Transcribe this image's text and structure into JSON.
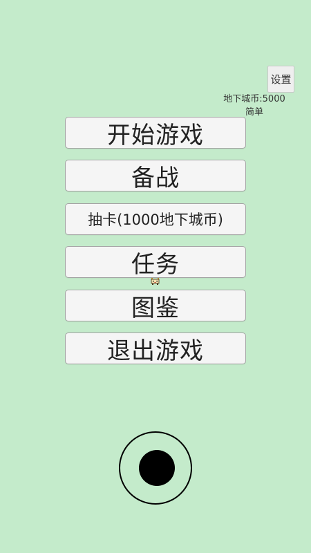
{
  "header": {
    "settings_label": "设置",
    "currency_text": "地下城币:5000",
    "difficulty_text": "简单"
  },
  "menu": {
    "start_game": "开始游戏",
    "prepare": "备战",
    "draw_card": "抽卡(1000地下城币)",
    "tasks": "任务",
    "codex": "图鉴",
    "exit_game": "退出游戏"
  },
  "colors": {
    "background": "#c4ebcb",
    "button_bg": "#f5f5f5",
    "button_border": "#a4a4a4",
    "joystick": "#000000"
  },
  "icons": {
    "pet": "small-pixel-creature-icon",
    "joystick": "virtual-joystick"
  }
}
